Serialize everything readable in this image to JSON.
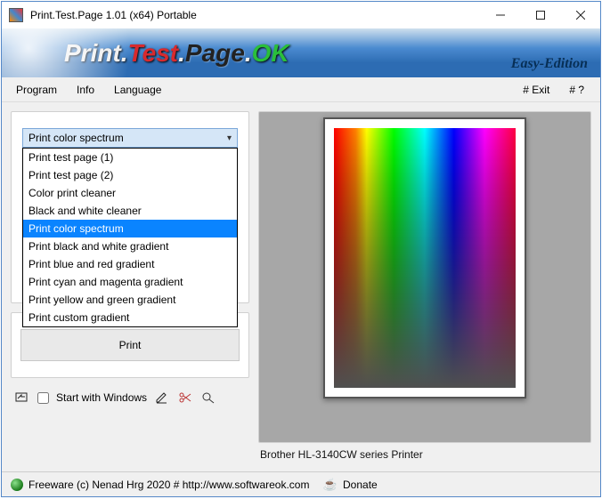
{
  "window": {
    "title": "Print.Test.Page 1.01  (x64) Portable"
  },
  "banner": {
    "w1": "Print",
    "w2": "Test",
    "w3": "Page",
    "w4": "OK",
    "edition": "Easy-Edition"
  },
  "menu": {
    "program": "Program",
    "info": "Info",
    "language": "Language",
    "exit": "# Exit",
    "help": "# ?"
  },
  "combo": {
    "selected_label": "Print color spectrum",
    "items": [
      "Print test page (1)",
      "Print test page (2)",
      "Color print cleaner",
      "Black and white cleaner",
      "Print color spectrum",
      "Print black and white gradient",
      "Print blue and red gradient",
      "Print cyan and magenta gradient",
      "Print yellow and green gradient",
      "Print custom gradient"
    ],
    "selected_index": 4
  },
  "buttons": {
    "print": "Print"
  },
  "startwith": {
    "label": "Start with Windows",
    "checked": false
  },
  "preview": {
    "caption": "Brother HL-3140CW series Printer"
  },
  "status": {
    "freeware": "Freeware (c) Nenad Hrg 2020 # http://www.softwareok.com",
    "donate": "Donate"
  }
}
